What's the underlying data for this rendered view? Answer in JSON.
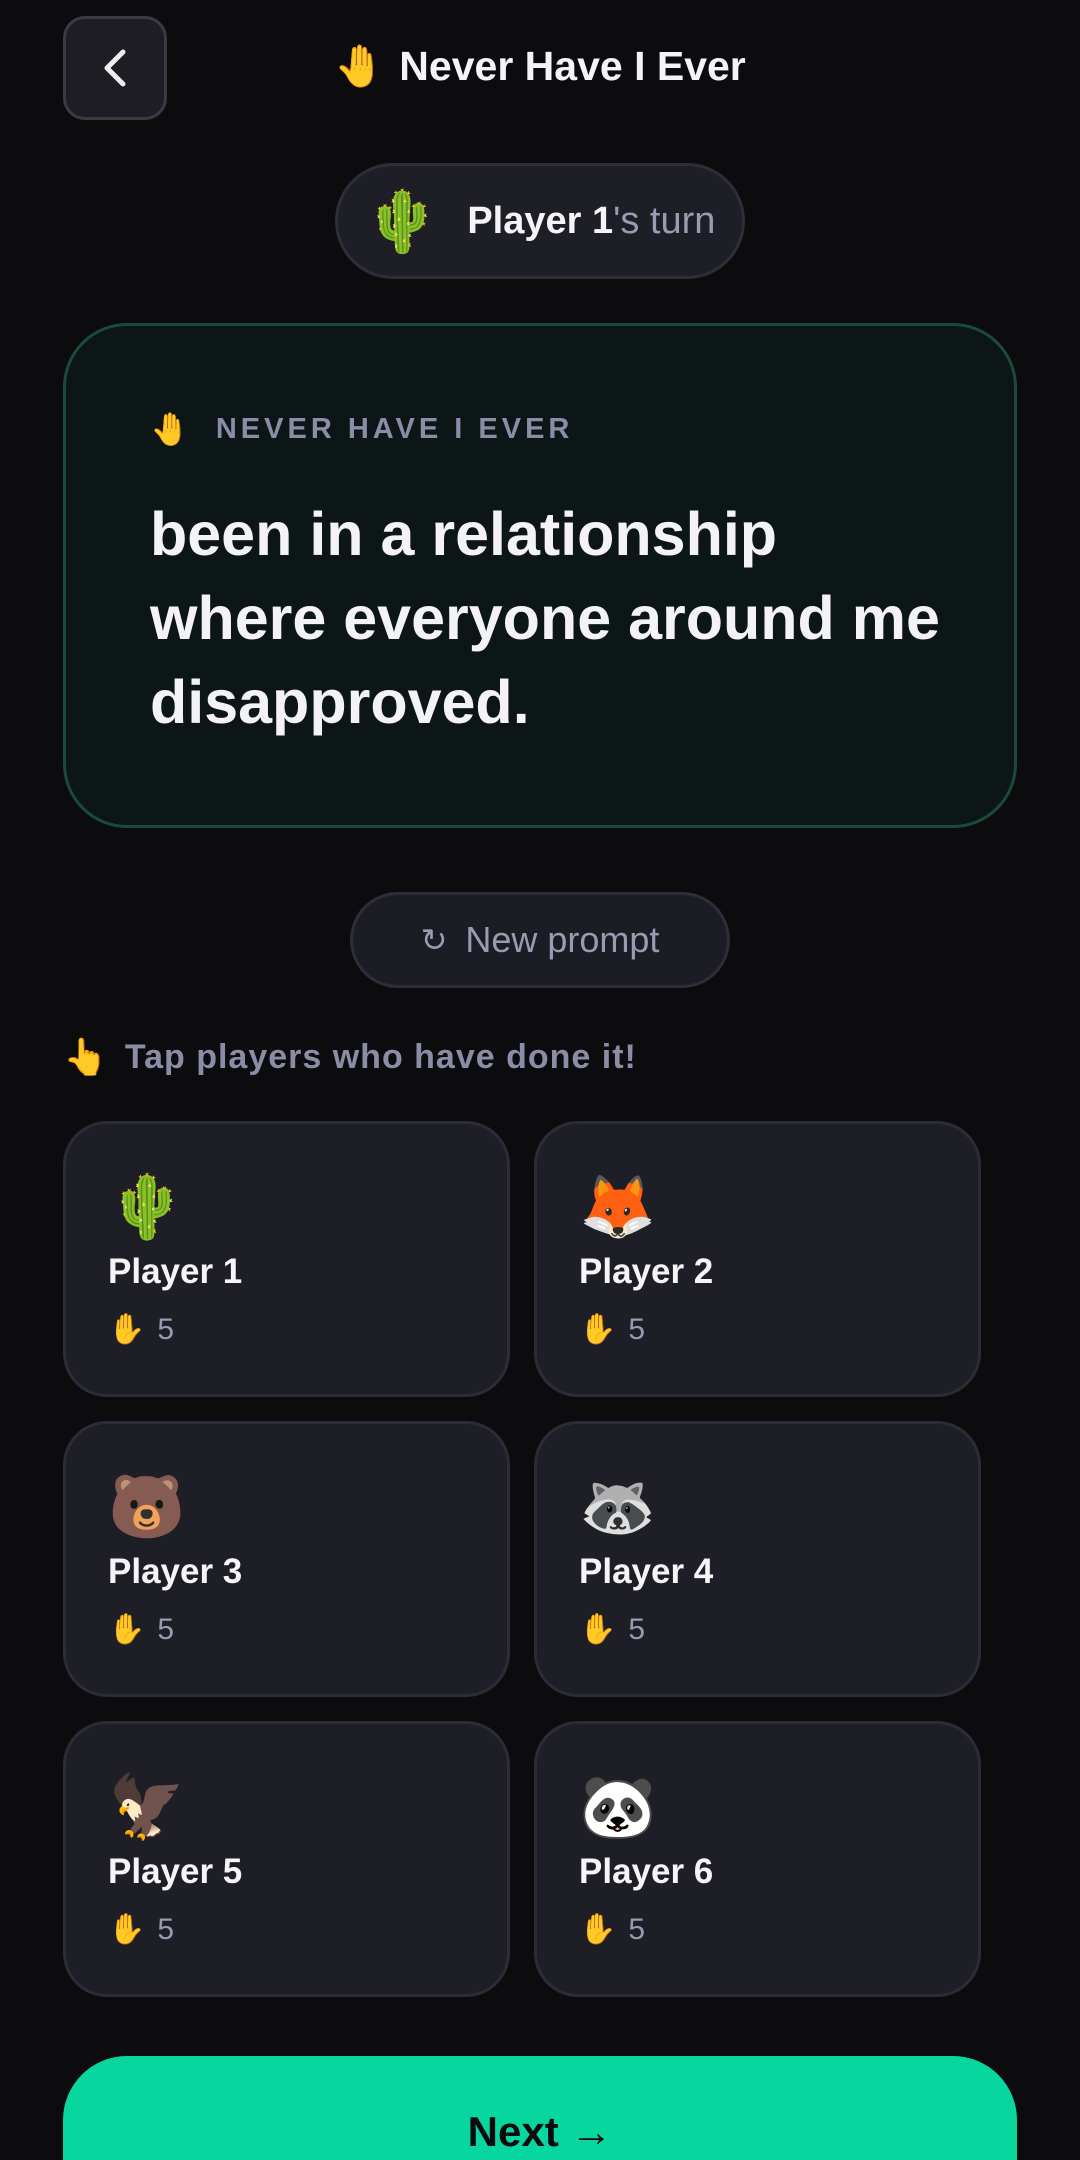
{
  "header": {
    "back_icon": "chevron-left-icon",
    "title_emoji": "🤚",
    "title": "Never Have I Ever"
  },
  "turn": {
    "avatar": "🌵",
    "name": "Player 1",
    "suffix": "'s turn"
  },
  "prompt": {
    "kicker_emoji": "🤚",
    "kicker": "NEVER HAVE I EVER",
    "text": "been in a relationship where everyone around me disapproved."
  },
  "new_prompt": {
    "icon": "↻",
    "label": "New prompt"
  },
  "hint": {
    "emoji": "👆",
    "text": "Tap players who have done it!"
  },
  "players": [
    {
      "avatar": "🌵",
      "name": "Player 1",
      "count_emoji": "✋",
      "count": "5"
    },
    {
      "avatar": "🦊",
      "name": "Player 2",
      "count_emoji": "✋",
      "count": "5"
    },
    {
      "avatar": "🐻",
      "name": "Player 3",
      "count_emoji": "✋",
      "count": "5"
    },
    {
      "avatar": "🦝",
      "name": "Player 4",
      "count_emoji": "✋",
      "count": "5"
    },
    {
      "avatar": "🦅",
      "name": "Player 5",
      "count_emoji": "✋",
      "count": "5"
    },
    {
      "avatar": "🐼",
      "name": "Player 6",
      "count_emoji": "✋",
      "count": "5"
    }
  ],
  "next": {
    "label": "Next →"
  },
  "colors": {
    "background": "#0c0c0e",
    "accent": "#07d69e",
    "card": "#1e1e27",
    "prompt_card": "#0c1616",
    "muted_text": "#9a9ab2"
  }
}
